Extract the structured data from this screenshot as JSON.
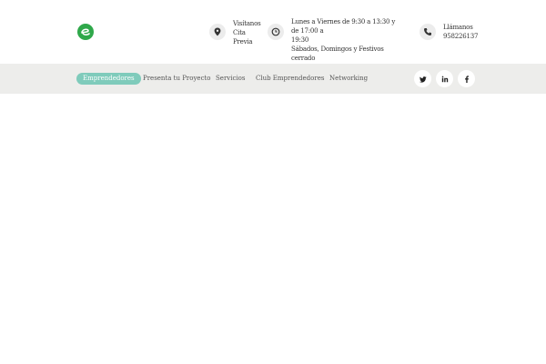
{
  "brand": {
    "logo_icon": "leaf-e-logo",
    "color": "#2fa84a"
  },
  "header": {
    "visit": {
      "icon": "location-pin-icon",
      "lines": [
        "Visítanos",
        "Cita",
        "Previa"
      ]
    },
    "hours": {
      "icon": "clock-icon",
      "lines": [
        "Lunes a Viernes de 9:30 a 13:30 y de 17:00 a",
        "19:30",
        "Sábados, Domingos y Festivos cerrado"
      ]
    },
    "call": {
      "icon": "phone-icon",
      "lines": [
        "Llámanos",
        "958226137"
      ]
    }
  },
  "nav": {
    "items": [
      {
        "label": "Emprendedores",
        "active": true
      },
      {
        "label": "Presenta tu Proyecto",
        "active": false
      },
      {
        "label": "Servicios",
        "active": false
      },
      {
        "label": "Club Emprendedores",
        "active": false
      },
      {
        "label": "Networking",
        "active": false
      }
    ],
    "active_color": "#7fcbbb"
  },
  "social": [
    {
      "icon": "twitter-icon",
      "label": "twitter"
    },
    {
      "icon": "linkedin-icon",
      "label": "linkedin"
    },
    {
      "icon": "facebook-icon",
      "label": "facebook"
    }
  ]
}
